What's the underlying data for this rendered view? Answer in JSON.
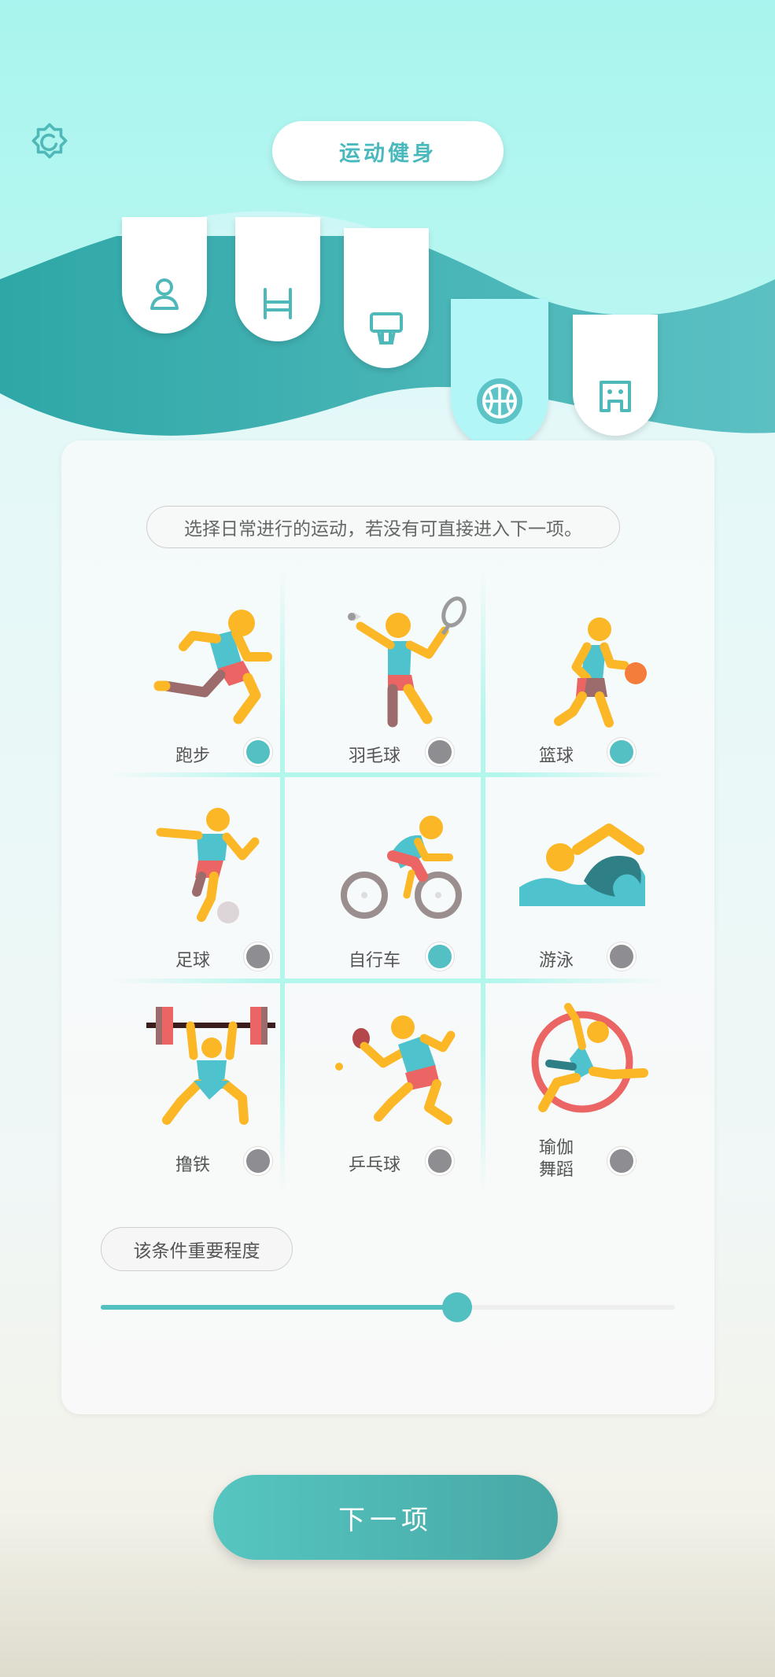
{
  "header": {
    "title": "运动健身"
  },
  "tabs": [
    {
      "icon": "person-icon",
      "active": false
    },
    {
      "icon": "bed-icon",
      "active": false
    },
    {
      "icon": "basketball-hoop-icon",
      "active": false
    },
    {
      "icon": "basketball-icon",
      "active": true
    },
    {
      "icon": "toilet-icon",
      "active": false
    }
  ],
  "hint": "选择日常进行的运动，若没有可直接进入下一项。",
  "sports": [
    {
      "label": "跑步",
      "selected": true,
      "icon": "running-icon"
    },
    {
      "label": "羽毛球",
      "selected": false,
      "icon": "badminton-icon"
    },
    {
      "label": "篮球",
      "selected": true,
      "icon": "basketball-player-icon"
    },
    {
      "label": "足球",
      "selected": false,
      "icon": "soccer-icon"
    },
    {
      "label": "自行车",
      "selected": true,
      "icon": "cycling-icon"
    },
    {
      "label": "游泳",
      "selected": false,
      "icon": "swimming-icon"
    },
    {
      "label": "撸铁",
      "selected": false,
      "icon": "weightlifting-icon"
    },
    {
      "label": "乒乓球",
      "selected": false,
      "icon": "table-tennis-icon"
    },
    {
      "label_line1": "瑜伽",
      "label_line2": "舞蹈",
      "selected": false,
      "icon": "yoga-dance-icon"
    }
  ],
  "importance": {
    "label": "该条件重要程度",
    "value": 0.62
  },
  "next_button": "下一项",
  "colors": {
    "accent": "#52bfc1",
    "figure_yellow": "#fbb726",
    "figure_teal": "#4ec3cd",
    "figure_red": "#ea6563",
    "off": "#8e8e92"
  }
}
